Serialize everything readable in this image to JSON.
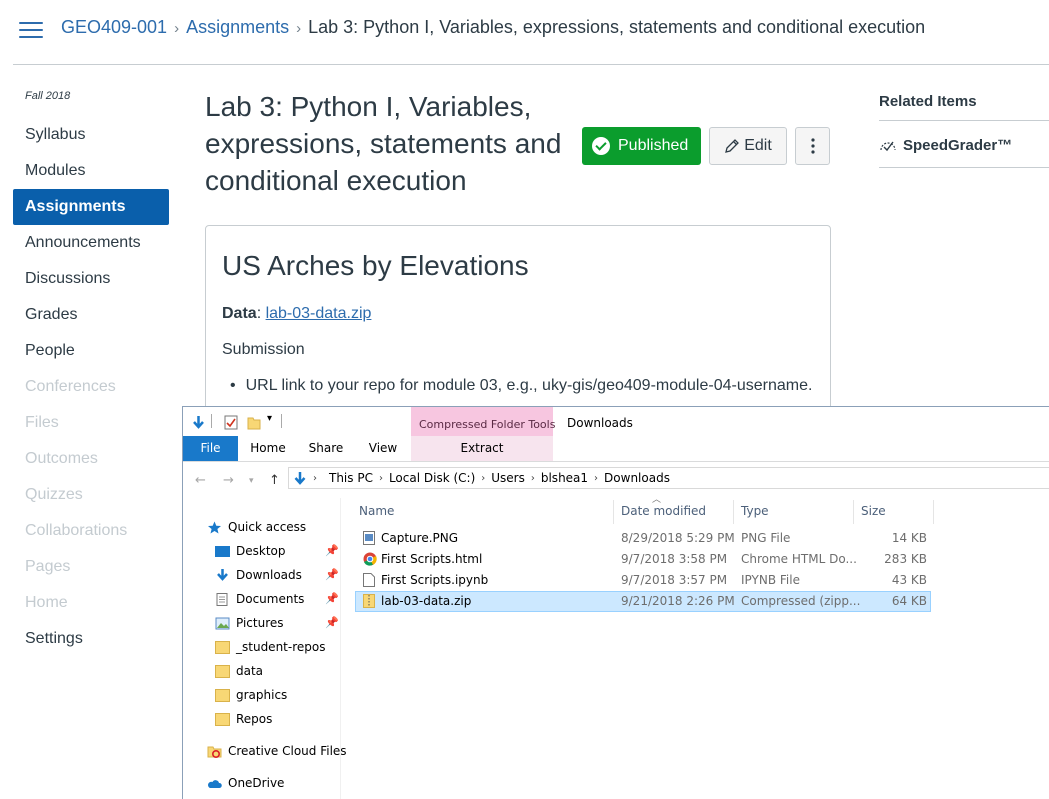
{
  "breadcrumb": {
    "course": "GEO409-001",
    "section": "Assignments",
    "current": "Lab 3: Python I, Variables, expressions, statements and conditional execution"
  },
  "course_nav": {
    "term": "Fall 2018",
    "items": [
      {
        "label": "Syllabus"
      },
      {
        "label": "Modules"
      },
      {
        "label": "Assignments"
      },
      {
        "label": "Announcements"
      },
      {
        "label": "Discussions"
      },
      {
        "label": "Grades"
      },
      {
        "label": "People"
      },
      {
        "label": "Conferences"
      },
      {
        "label": "Files"
      },
      {
        "label": "Outcomes"
      },
      {
        "label": "Quizzes"
      },
      {
        "label": "Collaborations"
      },
      {
        "label": "Pages"
      },
      {
        "label": "Home"
      },
      {
        "label": "Settings"
      }
    ]
  },
  "assignment": {
    "title": "Lab 3: Python I, Variables, expressions, statements and conditional execution",
    "published_label": "Published",
    "edit_label": "Edit",
    "description": {
      "heading": "US Arches by Elevations",
      "data_label": "Data",
      "data_link": "lab-03-data.zip",
      "submission_label": "Submission",
      "bullet": "URL link to your repo for module 03, e.g., uky-gis/geo409-module-04-username."
    }
  },
  "related": {
    "heading": "Related Items",
    "speedgrader": "SpeedGrader™"
  },
  "explorer": {
    "context_tab_group": "Compressed Folder Tools",
    "window_title": "Downloads",
    "tabs": {
      "file": "File",
      "home": "Home",
      "share": "Share",
      "view": "View",
      "extract": "Extract"
    },
    "address": [
      "This PC",
      "Local Disk (C:)",
      "Users",
      "blshea1",
      "Downloads"
    ],
    "nav_pane": {
      "quick_access": "Quick access",
      "items": [
        "Desktop",
        "Downloads",
        "Documents",
        "Pictures",
        "_student-repos",
        "data",
        "graphics",
        "Repos"
      ],
      "creative_cloud": "Creative Cloud Files",
      "onedrive": "OneDrive"
    },
    "columns": {
      "name": "Name",
      "date": "Date modified",
      "type": "Type",
      "size": "Size"
    },
    "files": [
      {
        "name": "Capture.PNG",
        "date": "8/29/2018 5:29 PM",
        "type": "PNG File",
        "size": "14 KB"
      },
      {
        "name": "First Scripts.html",
        "date": "9/7/2018 3:58 PM",
        "type": "Chrome HTML Do...",
        "size": "283 KB"
      },
      {
        "name": "First Scripts.ipynb",
        "date": "9/7/2018 3:57 PM",
        "type": "IPYNB File",
        "size": "43 KB"
      },
      {
        "name": "lab-03-data.zip",
        "date": "9/21/2018 2:26 PM",
        "type": "Compressed (zipp...",
        "size": "64 KB"
      }
    ]
  }
}
